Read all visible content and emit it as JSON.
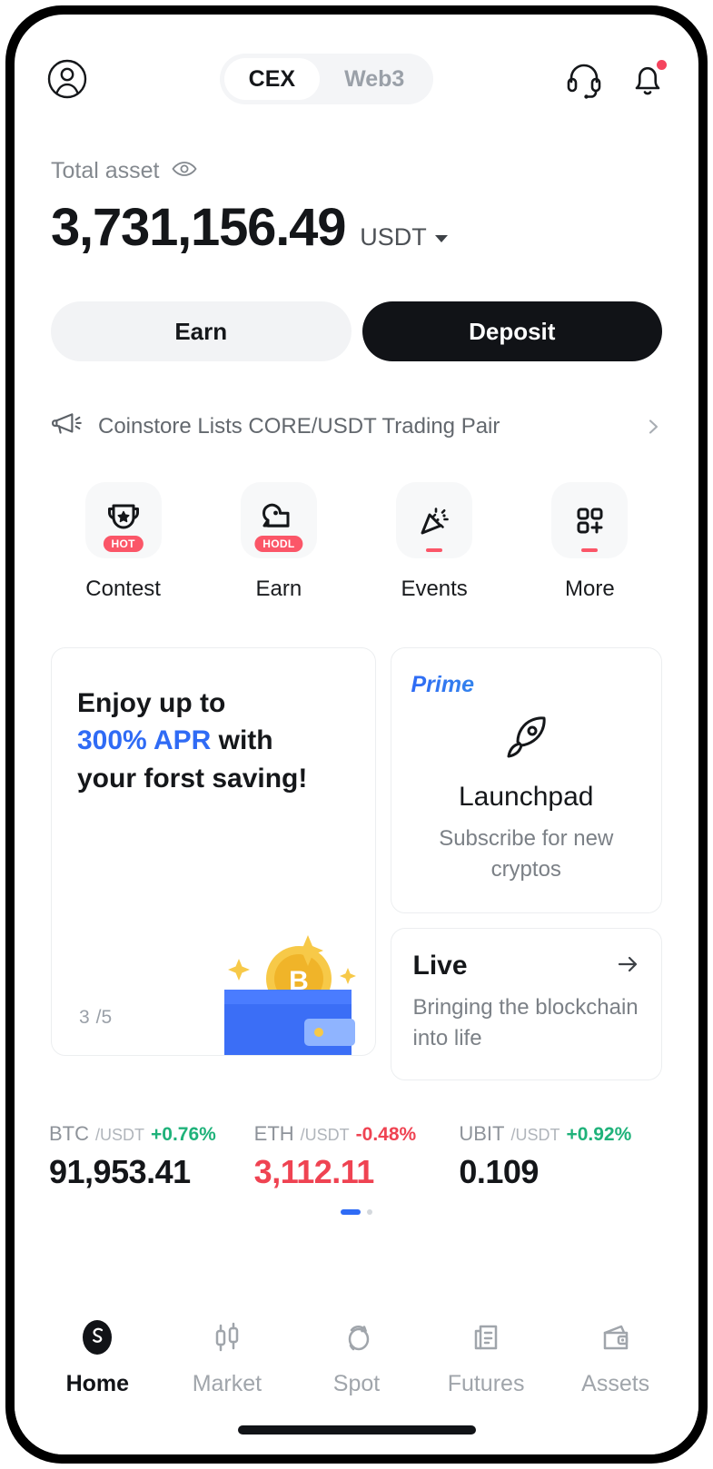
{
  "header": {
    "avatar_icon": "user-circle-icon",
    "segments": [
      {
        "label": "CEX",
        "active": true
      },
      {
        "label": "Web3",
        "active": false
      }
    ],
    "support_icon": "headset-icon",
    "notification_icon": "bell-icon",
    "notification_badge": true
  },
  "balance": {
    "label": "Total asset",
    "visibility_icon": "eye-icon",
    "amount": "3,731,156.49",
    "currency": "USDT",
    "currency_caret_icon": "chevron-down-icon"
  },
  "actions": {
    "earn_label": "Earn",
    "deposit_label": "Deposit"
  },
  "announcement": {
    "icon": "megaphone-icon",
    "text": "Coinstore Lists CORE/USDT Trading Pair",
    "chevron_icon": "chevron-right-icon"
  },
  "quick_actions": [
    {
      "label": "Contest",
      "icon": "trophy-icon",
      "badge": "HOT"
    },
    {
      "label": "Earn",
      "icon": "piggy-bank-icon",
      "badge": "HODL"
    },
    {
      "label": "Events",
      "icon": "party-popper-icon",
      "badge": ""
    },
    {
      "label": "More",
      "icon": "grid-plus-icon",
      "badge": ""
    }
  ],
  "promo": {
    "savings_card": {
      "line1": "Enjoy up to",
      "highlight": "300% APR",
      "line2_rest": " with",
      "line3": "your forst saving!",
      "counter_current": "3",
      "counter_total": "/5",
      "art_icon": "wallet-bitcoin-icon"
    },
    "launchpad_card": {
      "tag": "Prime",
      "icon": "rocket-icon",
      "title": "Launchpad",
      "subtitle": "Subscribe for new cryptos"
    },
    "live_card": {
      "title": "Live",
      "arrow_icon": "arrow-right-icon",
      "subtitle": "Bringing the blockchain into life"
    }
  },
  "tickers": {
    "items": [
      {
        "base": "BTC",
        "quote": "/USDT",
        "change": "+0.76%",
        "change_color": "#1fb27a",
        "price": "91,953.41",
        "price_color": "#141619"
      },
      {
        "base": "ETH",
        "quote": "/USDT",
        "change": "-0.48%",
        "change_color": "#ef4352",
        "price": "3,112.11",
        "price_color": "#ef4352"
      },
      {
        "base": "UBIT",
        "quote": "/USDT",
        "change": "+0.92%",
        "change_color": "#1fb27a",
        "price": "0.109",
        "price_color": "#141619"
      }
    ],
    "pager_active_index": 0,
    "pager_count": 2
  },
  "bottom_nav": [
    {
      "label": "Home",
      "icon": "home-logo-icon",
      "active": true
    },
    {
      "label": "Market",
      "icon": "candlestick-icon",
      "active": false
    },
    {
      "label": "Spot",
      "icon": "spot-trade-icon",
      "active": false
    },
    {
      "label": "Futures",
      "icon": "futures-doc-icon",
      "active": false
    },
    {
      "label": "Assets",
      "icon": "wallet-icon",
      "active": false
    }
  ],
  "colors": {
    "accent_blue": "#2f6bf5",
    "up_green": "#1fb27a",
    "down_red": "#ef4352",
    "badge_red": "#fb5668",
    "dark": "#111317"
  }
}
